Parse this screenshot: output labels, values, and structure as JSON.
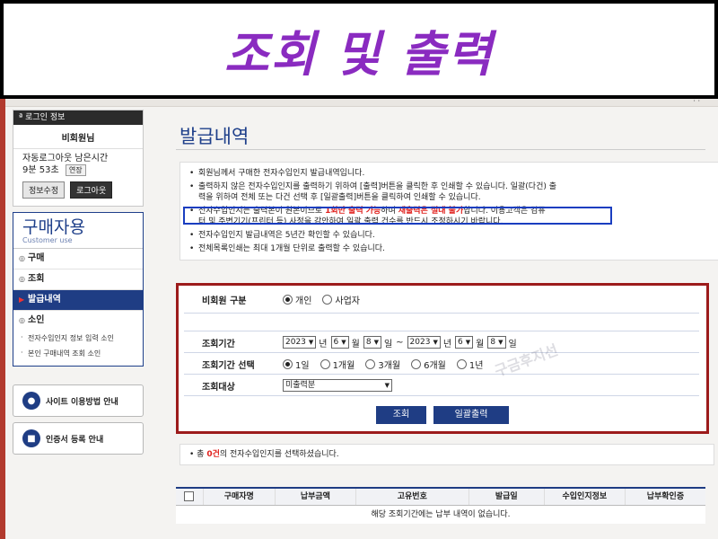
{
  "banner": {
    "title": "조회 및 출력"
  },
  "topbar": {
    "text": "· ·"
  },
  "login": {
    "header": "로그인 정보",
    "name": "비회원님",
    "time_label": "자동로그아웃 남은시간",
    "time_value": "9분 53초",
    "extend": "연장",
    "btn_info": "정보수정",
    "btn_logout": "로그아웃"
  },
  "menu": {
    "title": "구매자용",
    "subtitle": "Customer use",
    "items": [
      {
        "label": "구매"
      },
      {
        "label": "조회"
      },
      {
        "label": "발급내역"
      },
      {
        "label": "소인"
      }
    ],
    "subitems": [
      {
        "label": "전자수입인지 정보 입력 소인"
      },
      {
        "label": "본인 구매내역 조회 소인"
      }
    ]
  },
  "side_buttons": {
    "guide": "사이트 이용방법 안내",
    "cert": "인증서 등록 안내"
  },
  "page": {
    "title": "발급내역"
  },
  "notices": {
    "n1": "회원님께서 구매한 전자수입인지 발급내역입니다.",
    "n2a": "출력하지 않은 전자수입인지를 출력하기 위하여 [출력]버튼을 클릭한 후 인쇄할 수 있습니다. 일괄(다건) 출",
    "n2b": "력을 위하여 전체 또는 다건 선택 후 [일괄출력]버튼을 클릭하여 인쇄할 수 있습니다.",
    "n3_pre": "전자수입인지는 출력본이 원본이므로 ",
    "n3_red1": "1회만 출력 가능",
    "n3_mid": "하며 ",
    "n3_red2": "재출력은 절대 불가",
    "n3_post": "합니다. 이용고객은 컴퓨",
    "n3b": "터 및 주변기기(프린터 등) 사정을 감안하여 일괄 출력 건수를 반드시 조정하시기 바랍니다.",
    "n4": "전자수입인지 발급내역은 5년간 확인할 수 있습니다.",
    "n5": "전체목록인쇄는 최대 1개월 단위로 출력할 수 있습니다."
  },
  "search": {
    "member_label": "비회원 구분",
    "member_options": [
      "개인",
      "사업자"
    ],
    "member_selected": "개인",
    "period_label": "조회기간",
    "from_year": "2023",
    "from_month": "6",
    "from_day": "8",
    "to_year": "2023",
    "to_month": "6",
    "to_day": "8",
    "unit_year": "년",
    "unit_month": "월",
    "unit_day": "일",
    "tilde": "~",
    "period_select_label": "조회기간 선택",
    "period_options": [
      "1일",
      "1개월",
      "3개월",
      "6개월",
      "1년"
    ],
    "period_selected": "1일",
    "target_label": "조회대상",
    "target_value": "미출력분",
    "btn_search": "조회",
    "btn_print_all": "일괄출력",
    "watermark": "구금후지선"
  },
  "result": {
    "prefix": "총 ",
    "count": "0건",
    "suffix": "의 전자수입인지를 선택하셨습니다."
  },
  "table": {
    "columns": [
      "구매자명",
      "납부금액",
      "고유번호",
      "발급일",
      "수입인지정보",
      "납부확인증"
    ],
    "empty": "해당 조회기간에는 납부 내역이 없습니다."
  }
}
